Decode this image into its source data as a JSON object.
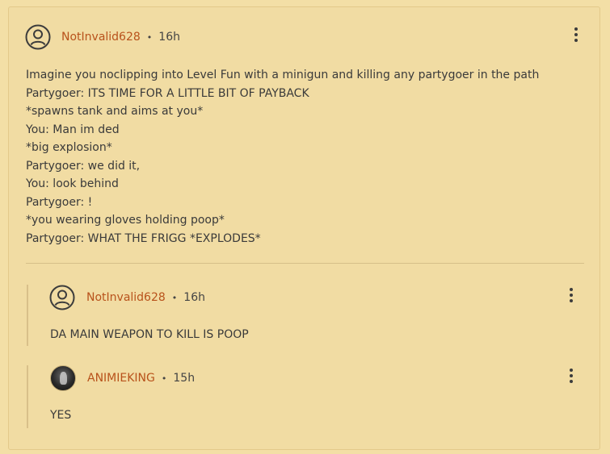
{
  "comment": {
    "username": "NotInvalid628",
    "separator": "•",
    "time": "16h",
    "lines": [
      "Imagine you noclipping into Level Fun with a minigun and killing any partygoer in the path",
      "Partygoer: ITS TIME FOR A LITTLE BIT OF PAYBACK",
      "*spawns tank and aims at you*",
      "You: Man im ded",
      "*big explosion*",
      "Partygoer: we did it,",
      "You: look behind",
      "Partygoer: !",
      "*you wearing gloves holding poop*",
      "Partygoer: WHAT THE FRIGG *EXPLODES*"
    ]
  },
  "replies": [
    {
      "username": "NotInvalid628",
      "separator": "•",
      "time": "16h",
      "text": "DA MAIN WEAPON TO KILL IS POOP",
      "avatar": "user-outline-icon"
    },
    {
      "username": "ANIMIEKING",
      "separator": "•",
      "time": "15h",
      "text": "YES",
      "avatar": "profile-photo"
    }
  ],
  "colors": {
    "background": "#f3dfa6",
    "username": "#b8521b",
    "text": "#3a3a3a"
  }
}
